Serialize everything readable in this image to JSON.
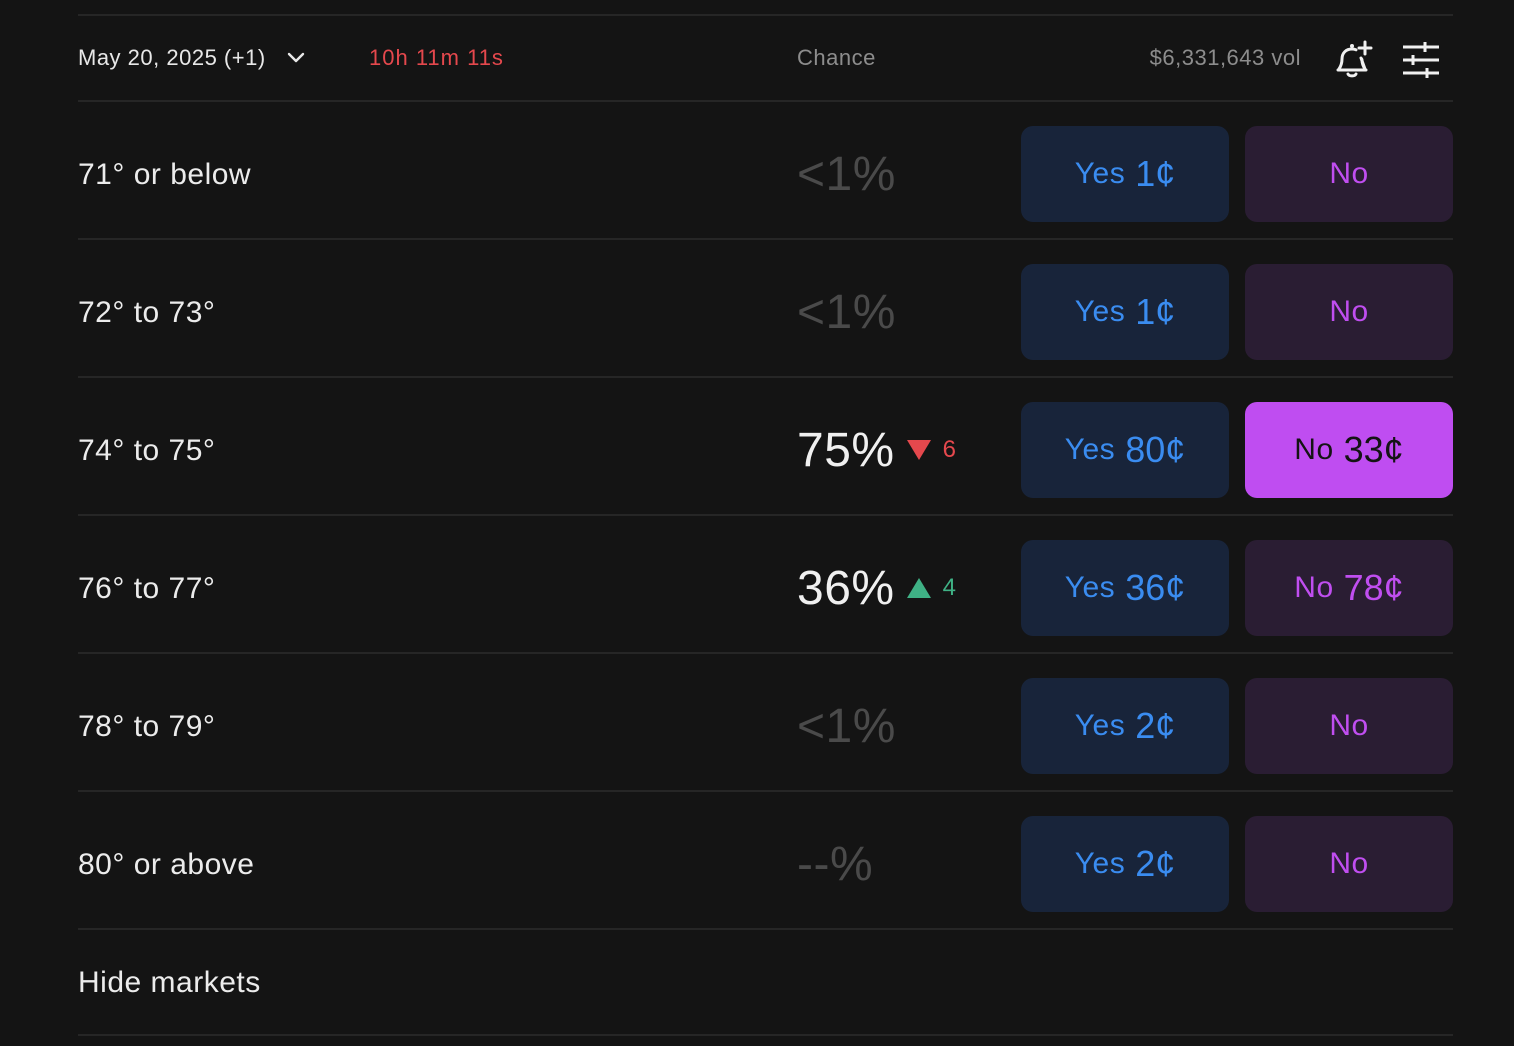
{
  "header": {
    "date_label": "May 20, 2025 (+1)",
    "countdown": "10h 11m 11s",
    "chance_label": "Chance",
    "volume": "$6,331,643 vol"
  },
  "markets": [
    {
      "label": "71° or below",
      "chance": "<1%",
      "delta": "",
      "yes": {
        "label": "Yes",
        "price": "1¢"
      },
      "no": {
        "label": "No",
        "price": ""
      }
    },
    {
      "label": "72° to 73°",
      "chance": "<1%",
      "delta": "",
      "yes": {
        "label": "Yes",
        "price": "1¢"
      },
      "no": {
        "label": "No",
        "price": ""
      }
    },
    {
      "label": "74° to 75°",
      "chance": "75%",
      "delta": "6",
      "delta_direction": "down",
      "yes": {
        "label": "Yes",
        "price": "80¢"
      },
      "no": {
        "label": "No",
        "price": "33¢",
        "selected": true
      }
    },
    {
      "label": "76° to 77°",
      "chance": "36%",
      "delta": "4",
      "delta_direction": "up",
      "yes": {
        "label": "Yes",
        "price": "36¢"
      },
      "no": {
        "label": "No",
        "price": "78¢"
      }
    },
    {
      "label": "78° to 79°",
      "chance": "<1%",
      "delta": "",
      "yes": {
        "label": "Yes",
        "price": "2¢"
      },
      "no": {
        "label": "No",
        "price": ""
      }
    },
    {
      "label": "80° or above",
      "chance": "--%",
      "delta": "",
      "yes": {
        "label": "Yes",
        "price": "2¢"
      },
      "no": {
        "label": "No",
        "price": ""
      }
    }
  ],
  "footer": {
    "hide_markets_label": "Hide markets"
  },
  "colors": {
    "background": "#141414",
    "yes_bg": "#18243a",
    "yes_text": "#3a8cf0",
    "no_bg": "#2a1d33",
    "no_text": "#c04ef0",
    "no_selected_bg": "#bf4df1",
    "down": "#e5484d",
    "up": "#3fb185"
  },
  "icons": {
    "date_chevron": "chevron-down-icon",
    "alert": "bell-plus-icon",
    "filters": "sliders-icon"
  }
}
